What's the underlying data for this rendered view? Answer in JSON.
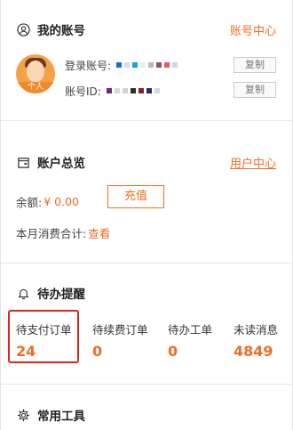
{
  "account": {
    "title": "我的账号",
    "link": "账号中心",
    "avatar_tag": "个人",
    "login_label": "登录账号:",
    "id_label": "账号ID:",
    "copy_label": "复制",
    "login_mask_colors": [
      "#1a6fb8",
      "#cfe3f2",
      "#16a3d6",
      "#e7eef5",
      "#b7b7b7",
      "#8a5a5a",
      "#e85a6a",
      "#cfd8e0"
    ],
    "id_mask_colors": [
      "#6e2a7a",
      "#d8d8d8",
      "#cfd2d8",
      "#2c2c2c",
      "#8a1f2b",
      "#22305e",
      "#d6d6d6"
    ]
  },
  "overview": {
    "title": "账户总览",
    "link": "用户中心",
    "balance_label": "余额:",
    "balance_value": "¥ 0.00",
    "recharge_label": "充值",
    "month_label": "本月消费合计:",
    "month_link": "查看"
  },
  "todo": {
    "title": "待办提醒",
    "items": [
      {
        "label": "待支付订单",
        "value": "24"
      },
      {
        "label": "待续费订单",
        "value": "0"
      },
      {
        "label": "待办工单",
        "value": "0"
      },
      {
        "label": "未读消息",
        "value": "4849"
      }
    ]
  },
  "tools": {
    "title": "常用工具"
  },
  "colors": {
    "accent": "#f06c22",
    "highlight": "#e2231a"
  }
}
